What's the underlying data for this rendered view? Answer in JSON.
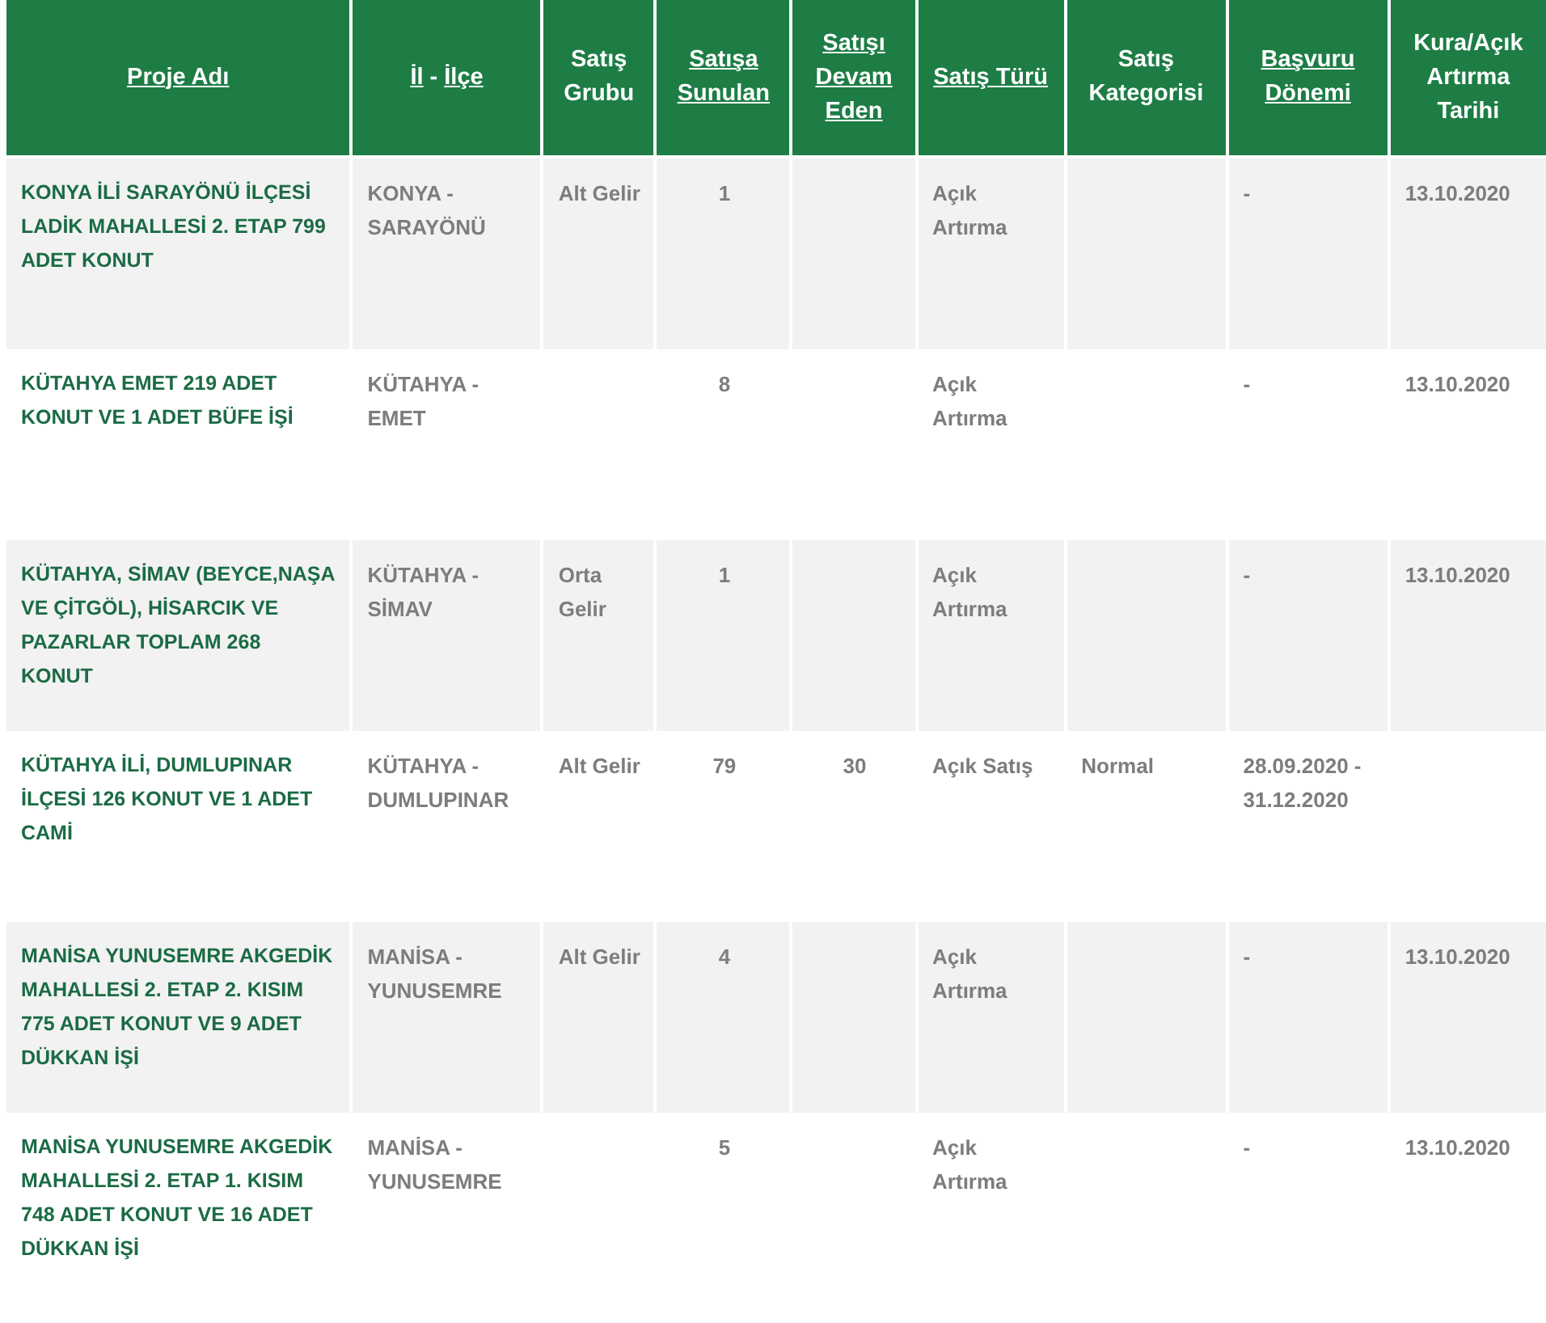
{
  "table": {
    "columns": [
      {
        "parts": [
          {
            "text": "Proje Adı",
            "link": true
          }
        ]
      },
      {
        "parts": [
          {
            "text": "İl",
            "link": true
          },
          {
            "text": " - ",
            "link": false
          },
          {
            "text": "İlçe",
            "link": true
          }
        ]
      },
      {
        "parts": [
          {
            "text": "Satış Grubu",
            "link": false
          }
        ]
      },
      {
        "parts": [
          {
            "text": "Satışa Sunulan",
            "link": true
          }
        ]
      },
      {
        "parts": [
          {
            "text": "Satışı Devam Eden",
            "link": true
          }
        ]
      },
      {
        "parts": [
          {
            "text": "Satış Türü",
            "link": true
          }
        ]
      },
      {
        "parts": [
          {
            "text": "Satış Kategorisi",
            "link": false
          }
        ]
      },
      {
        "parts": [
          {
            "text": "Başvuru Dönemi",
            "link": true
          }
        ]
      },
      {
        "parts": [
          {
            "text": "Kura/Açık Artırma Tarihi",
            "link": false
          }
        ]
      }
    ],
    "rows": [
      {
        "cells": [
          "KONYA İLİ SARAYÖNÜ İLÇESİ LADİK MAHALLESİ 2. ETAP 799 ADET KONUT",
          "KONYA - SARAYÖNÜ",
          "Alt Gelir",
          "1",
          "",
          "Açık Artırma",
          "",
          "-",
          "13.10.2020"
        ]
      },
      {
        "cells": [
          "KÜTAHYA EMET 219 ADET KONUT VE 1 ADET BÜFE İŞİ",
          "KÜTAHYA - EMET",
          "",
          "8",
          "",
          "Açık Artırma",
          "",
          "-",
          "13.10.2020"
        ]
      },
      {
        "cells": [
          "KÜTAHYA, SİMAV (BEYCE,NAŞA VE ÇİTGÖL), HİSARCIK VE PAZARLAR TOPLAM 268 KONUT",
          "KÜTAHYA - SİMAV",
          "Orta Gelir",
          "1",
          "",
          "Açık Artırma",
          "",
          "-",
          "13.10.2020"
        ]
      },
      {
        "cells": [
          "KÜTAHYA İLİ, DUMLUPINAR İLÇESİ 126 KONUT VE 1 ADET CAMİ",
          "KÜTAHYA - DUMLUPINAR",
          "Alt Gelir",
          "79",
          "30",
          "Açık Satış",
          "Normal",
          "28.09.2020 - 31.12.2020",
          ""
        ]
      },
      {
        "cells": [
          "MANİSA YUNUSEMRE AKGEDİK MAHALLESİ 2. ETAP 2. KISIM 775 ADET KONUT VE 9 ADET DÜKKAN İŞİ",
          "MANİSA - YUNUSEMRE",
          "Alt Gelir",
          "4",
          "",
          "Açık Artırma",
          "",
          "-",
          "13.10.2020"
        ]
      },
      {
        "cells": [
          "MANİSA YUNUSEMRE AKGEDİK MAHALLESİ 2. ETAP 1. KISIM 748 ADET KONUT VE 16 ADET DÜKKAN İŞİ",
          "MANİSA - YUNUSEMRE",
          "",
          "5",
          "",
          "Açık Artırma",
          "",
          "-",
          "13.10.2020"
        ]
      }
    ]
  }
}
